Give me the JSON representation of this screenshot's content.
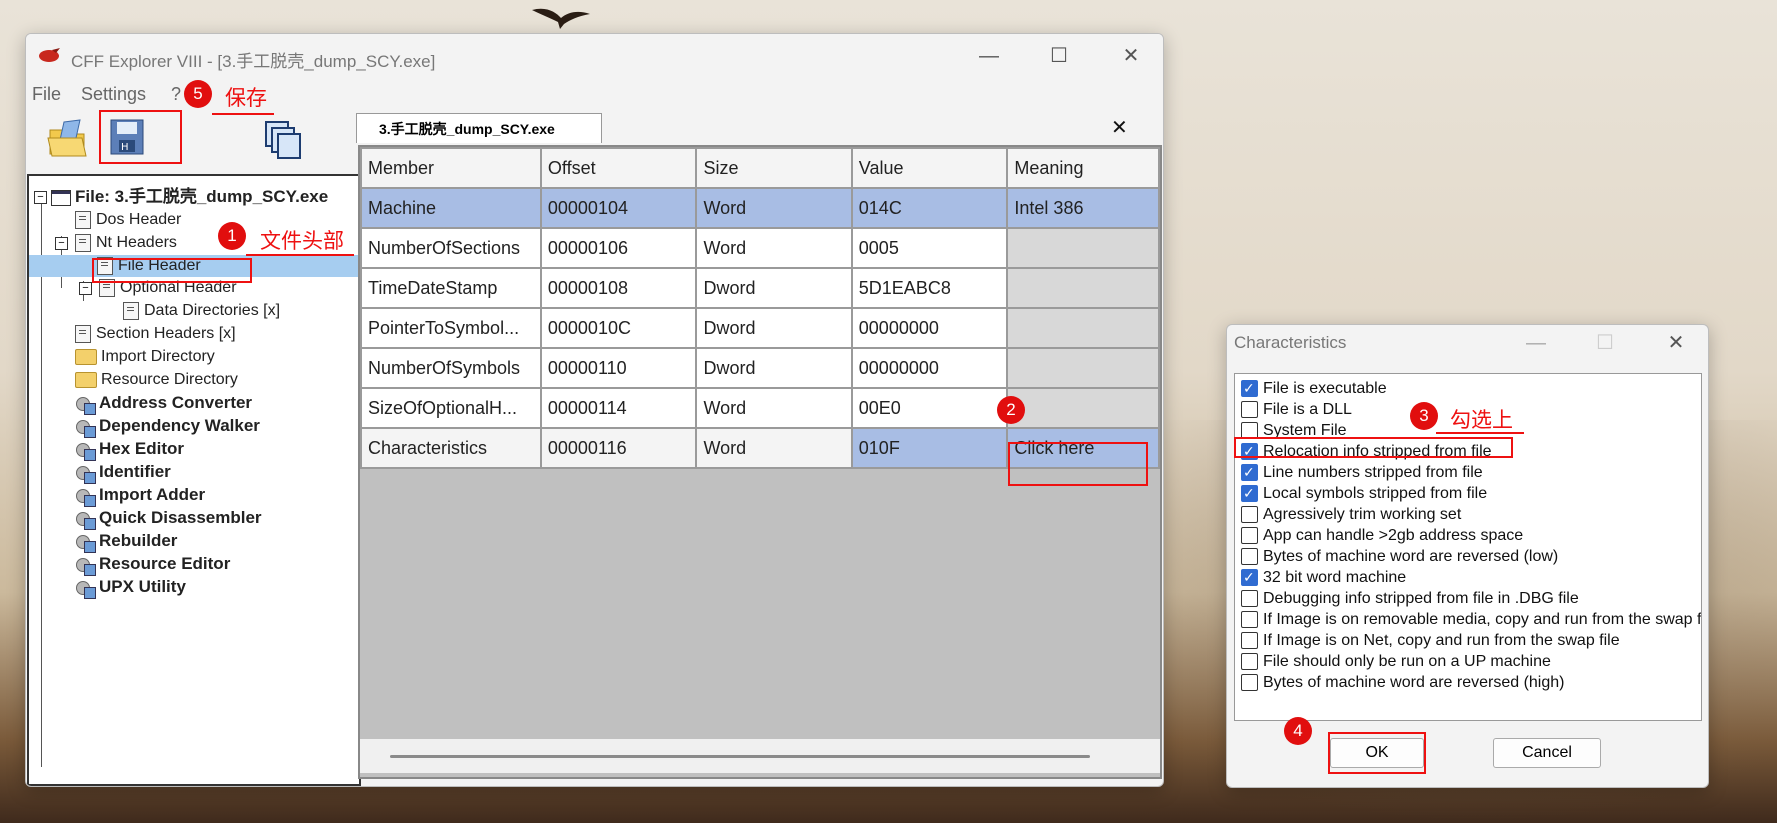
{
  "window": {
    "title": "CFF Explorer VIII - [3.手工脱壳_dump_SCY.exe]",
    "minimize": "—",
    "maximize": "☐",
    "close": "✕"
  },
  "menu": {
    "file": "File",
    "settings": "Settings",
    "help": "?"
  },
  "tree": {
    "root": "File: 3.手工脱壳_dump_SCY.exe",
    "dos_header": "Dos Header",
    "nt_headers": "Nt Headers",
    "file_header": "File Header",
    "optional_header": "Optional Header",
    "data_directories": "Data Directories [x]",
    "section_headers": "Section Headers [x]",
    "import_directory": "Import Directory",
    "resource_directory": "Resource Directory",
    "tools": [
      "Address Converter",
      "Dependency Walker",
      "Hex Editor",
      "Identifier",
      "Import Adder",
      "Quick Disassembler",
      "Rebuilder",
      "Resource Editor",
      "UPX Utility"
    ]
  },
  "tab": {
    "label": "3.手工脱壳_dump_SCY.exe",
    "close": "✕"
  },
  "grid": {
    "headers": [
      "Member",
      "Offset",
      "Size",
      "Value",
      "Meaning"
    ],
    "rows": [
      [
        "Machine",
        "00000104",
        "Word",
        "014C",
        "Intel 386"
      ],
      [
        "NumberOfSections",
        "00000106",
        "Word",
        "0005",
        ""
      ],
      [
        "TimeDateStamp",
        "00000108",
        "Dword",
        "5D1EABC8",
        ""
      ],
      [
        "PointerToSymbol...",
        "0000010C",
        "Dword",
        "00000000",
        ""
      ],
      [
        "NumberOfSymbols",
        "00000110",
        "Dword",
        "00000000",
        ""
      ],
      [
        "SizeOfOptionalH...",
        "00000114",
        "Word",
        "00E0",
        ""
      ],
      [
        "Characteristics",
        "00000116",
        "Word",
        "010F",
        "Click here"
      ]
    ]
  },
  "dialog": {
    "title": "Characteristics",
    "minimize": "—",
    "maximize": "☐",
    "close": "✕",
    "items": [
      {
        "label": "File is executable",
        "checked": true
      },
      {
        "label": "File is a DLL",
        "checked": false
      },
      {
        "label": "System File",
        "checked": false
      },
      {
        "label": "Relocation info stripped from file",
        "checked": true
      },
      {
        "label": "Line numbers stripped from file",
        "checked": true
      },
      {
        "label": "Local symbols stripped from file",
        "checked": true
      },
      {
        "label": "Agressively trim working set",
        "checked": false
      },
      {
        "label": "App can handle >2gb address space",
        "checked": false
      },
      {
        "label": "Bytes of machine word are reversed (low)",
        "checked": false
      },
      {
        "label": "32 bit word machine",
        "checked": true
      },
      {
        "label": "Debugging info stripped from file in .DBG file",
        "checked": false
      },
      {
        "label": "If Image is on removable media, copy and run from the swap file",
        "checked": false
      },
      {
        "label": "If Image is on Net, copy and run from the swap file",
        "checked": false
      },
      {
        "label": "File should only be run on a UP machine",
        "checked": false
      },
      {
        "label": "Bytes of machine word are reversed (high)",
        "checked": false
      }
    ],
    "ok": "OK",
    "cancel": "Cancel"
  },
  "annotations": {
    "step1": "1",
    "step1_text": "文件头部",
    "step2": "2",
    "step3": "3",
    "step3_text": "勾选上",
    "step4": "4",
    "step5": "5",
    "step5_text": "保存"
  },
  "colors": {
    "annotation": "#e11111",
    "selection": "#a8bde4",
    "checkbox": "#2f6bd1"
  }
}
